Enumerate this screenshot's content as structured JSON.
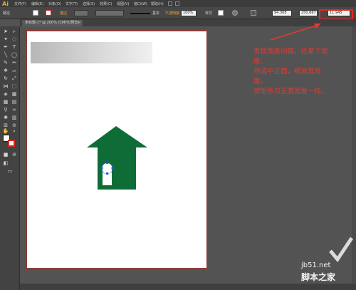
{
  "app": {
    "logo": "Ai"
  },
  "menu": {
    "items": [
      "文件(F)",
      "编辑(E)",
      "对象(O)",
      "文字(T)",
      "选择(S)",
      "效果(C)",
      "视图(V)",
      "窗口(W)",
      "帮助(H)"
    ]
  },
  "control_bar": {
    "selection_label": "路径",
    "stroke_label": "描边",
    "stroke_value": "基本",
    "opacity_label": "不透明度",
    "opacity_value": "100%",
    "style_label": "样式",
    "x_value": "94.308",
    "y_value": "250.667",
    "width_value": "11.945",
    "highlight_color": "#e5261e"
  },
  "document": {
    "tab_title": "未标题-1* @ 200% (CMYK/预览)",
    "close": "×"
  },
  "annotation": {
    "lines": [
      "发现宽度问题，还差下宽",
      "度。",
      "然选中正圆，缩放其宽",
      "度。",
      "使矩形与正圆宽度一样。"
    ],
    "color": "#e53a2f"
  },
  "watermark": {
    "url": "jb51.net",
    "logo_text": "脚本之家"
  },
  "colors": {
    "house_fill": "#0e6d36",
    "door_fill": "#ffffff",
    "selection_blue": "#2a5ad8"
  }
}
